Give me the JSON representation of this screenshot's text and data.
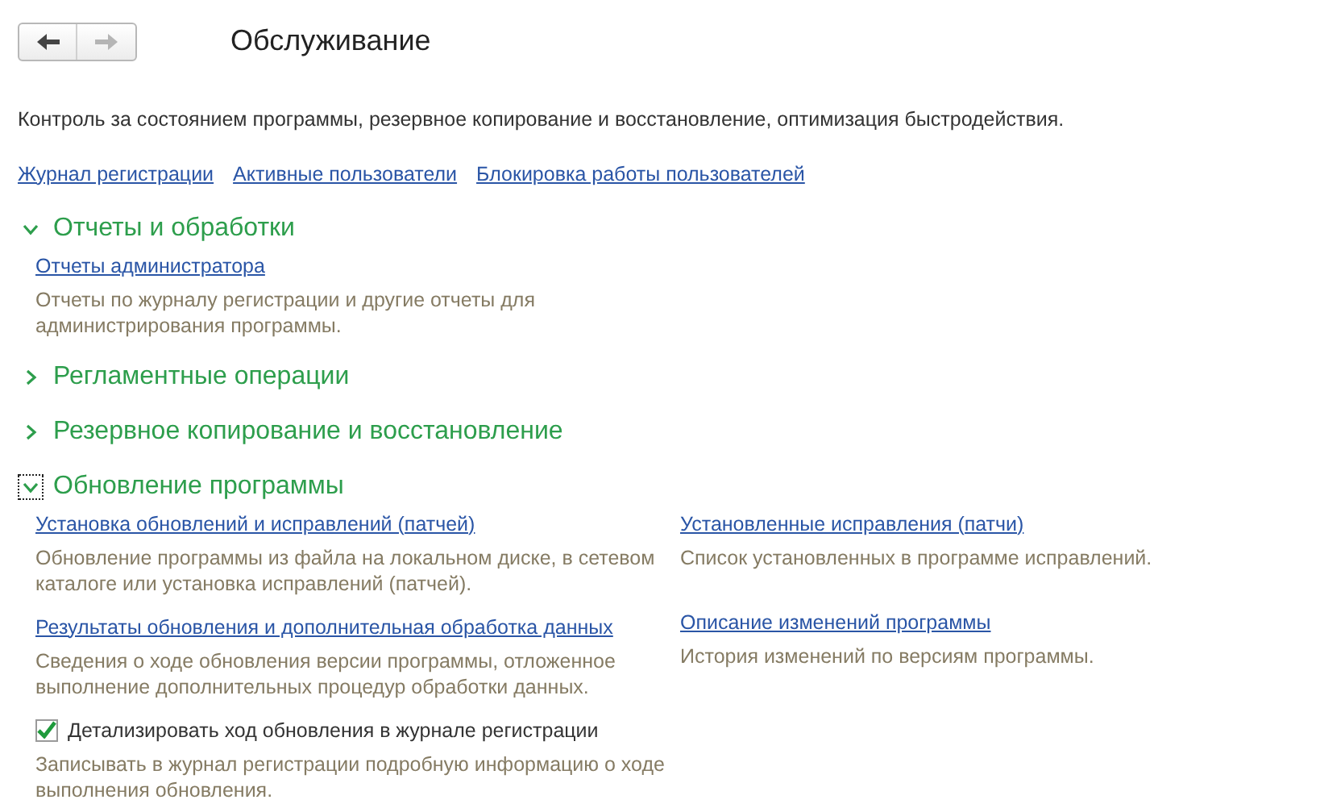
{
  "navigation": {
    "back": {
      "disabled": false
    },
    "forward": {
      "disabled": true
    }
  },
  "title": "Обслуживание",
  "description": "Контроль за состоянием программы, резервное копирование и восстановление, оптимизация быстродействия.",
  "top_links": [
    "Журнал регистрации",
    "Активные пользователи",
    "Блокировка работы пользователей"
  ],
  "sections": [
    {
      "title": "Отчеты и обработки",
      "expanded": true,
      "focused": false,
      "columns": [
        [
          {
            "kind": "link",
            "label": "Отчеты администратора",
            "description": "Отчеты по журналу регистрации и другие отчеты для администрирования программы."
          }
        ]
      ]
    },
    {
      "title": "Регламентные операции",
      "expanded": false,
      "focused": false
    },
    {
      "title": "Резервное копирование и восстановление",
      "expanded": false,
      "focused": false
    },
    {
      "title": "Обновление программы",
      "expanded": true,
      "focused": true,
      "columns": [
        [
          {
            "kind": "link",
            "label": "Установка обновлений и исправлений (патчей)",
            "description": "Обновление программы из файла на локальном диске, в сетевом каталоге или установка исправлений (патчей)."
          },
          {
            "kind": "link",
            "label": "Результаты обновления и дополнительная обработка данных",
            "description": "Сведения о ходе обновления версии программы, отложенное выполнение дополнительных процедур обработки данных."
          },
          {
            "kind": "checkbox",
            "label": "Детализировать ход обновления в журнале регистрации",
            "checked": true,
            "description": "Записывать в журнал регистрации подробную информацию о ходе выполнения обновления."
          }
        ],
        [
          {
            "kind": "link",
            "label": "Установленные исправления (патчи)",
            "description": "Список установленных в программе исправлений."
          },
          {
            "kind": "link",
            "label": "Описание изменений программы",
            "description": "История изменений по версиям программы."
          }
        ]
      ]
    }
  ]
}
